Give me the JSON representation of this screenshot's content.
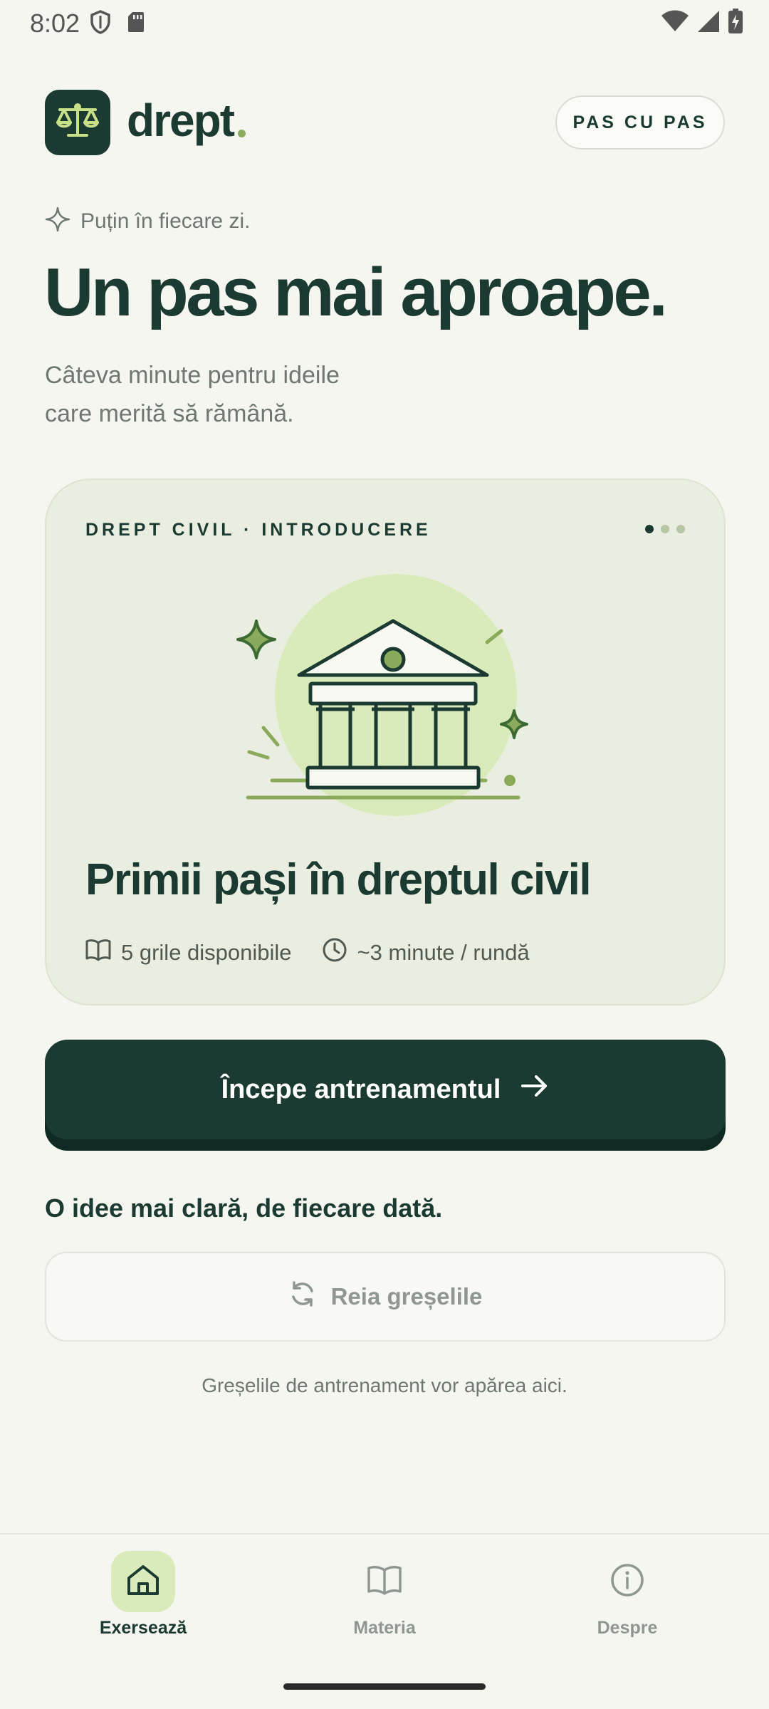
{
  "status": {
    "time": "8:02"
  },
  "header": {
    "brand": "drept",
    "pill_label": "PAS CU PAS"
  },
  "hero": {
    "tagline": "Puțin în fiecare zi.",
    "title": "Un pas mai aproape.",
    "subtitle_line1": "Câteva minute pentru ideile",
    "subtitle_line2": "care merită să rămână."
  },
  "card": {
    "eyebrow": "DREPT CIVIL · INTRODUCERE",
    "title": "Primii pași în dreptul civil",
    "meta_grile": "5 grile disponibile",
    "meta_time": "~3 minute / rundă",
    "page_count": 3,
    "active_page": 1
  },
  "actions": {
    "primary_label": "Începe antrenamentul",
    "section_title": "O idee mai clară, de fiecare dată.",
    "retry_label": "Reia greșelile",
    "retry_hint": "Greșelile de antrenament vor apărea aici."
  },
  "nav": {
    "items": [
      {
        "label": "Exersează",
        "icon": "home-icon",
        "active": true
      },
      {
        "label": "Materia",
        "icon": "book-icon",
        "active": false
      },
      {
        "label": "Despre",
        "icon": "info-icon",
        "active": false
      }
    ]
  },
  "colors": {
    "primary": "#1b3a31",
    "accent": "#8aab5b",
    "card_bg": "#eaeee0",
    "nav_active_bg": "#d9ebbb",
    "muted": "#6e7770"
  }
}
